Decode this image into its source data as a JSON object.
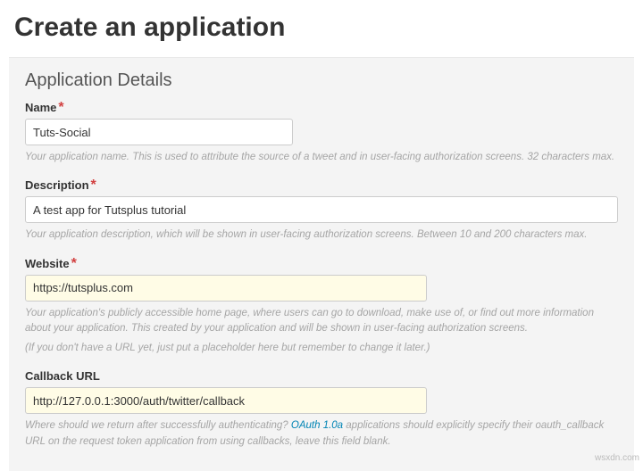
{
  "page": {
    "title": "Create an application",
    "section_title": "Application Details"
  },
  "fields": {
    "name": {
      "label": "Name",
      "required_mark": "*",
      "value": "Tuts-Social",
      "help": "Your application name. This is used to attribute the source of a tweet and in user-facing authorization screens. 32 characters max."
    },
    "description": {
      "label": "Description",
      "required_mark": "*",
      "value": "A test app for Tutsplus tutorial",
      "help": "Your application description, which will be shown in user-facing authorization screens. Between 10 and 200 characters max."
    },
    "website": {
      "label": "Website",
      "required_mark": "*",
      "value": "https://tutsplus.com",
      "help1": "Your application's publicly accessible home page, where users can go to download, make use of, or find out more information about your application. This created by your application and will be shown in user-facing authorization screens.",
      "help2": "(If you don't have a URL yet, just put a placeholder here but remember to change it later.)"
    },
    "callback": {
      "label": "Callback URL",
      "value": "http://127.0.0.1:3000/auth/twitter/callback",
      "help_pre": "Where should we return after successfully authenticating? ",
      "link_text": "OAuth 1.0a",
      "help_post": " applications should explicitly specify their oauth_callback URL on the request token application from using callbacks, leave this field blank."
    }
  },
  "watermark": "wsxdn.com"
}
